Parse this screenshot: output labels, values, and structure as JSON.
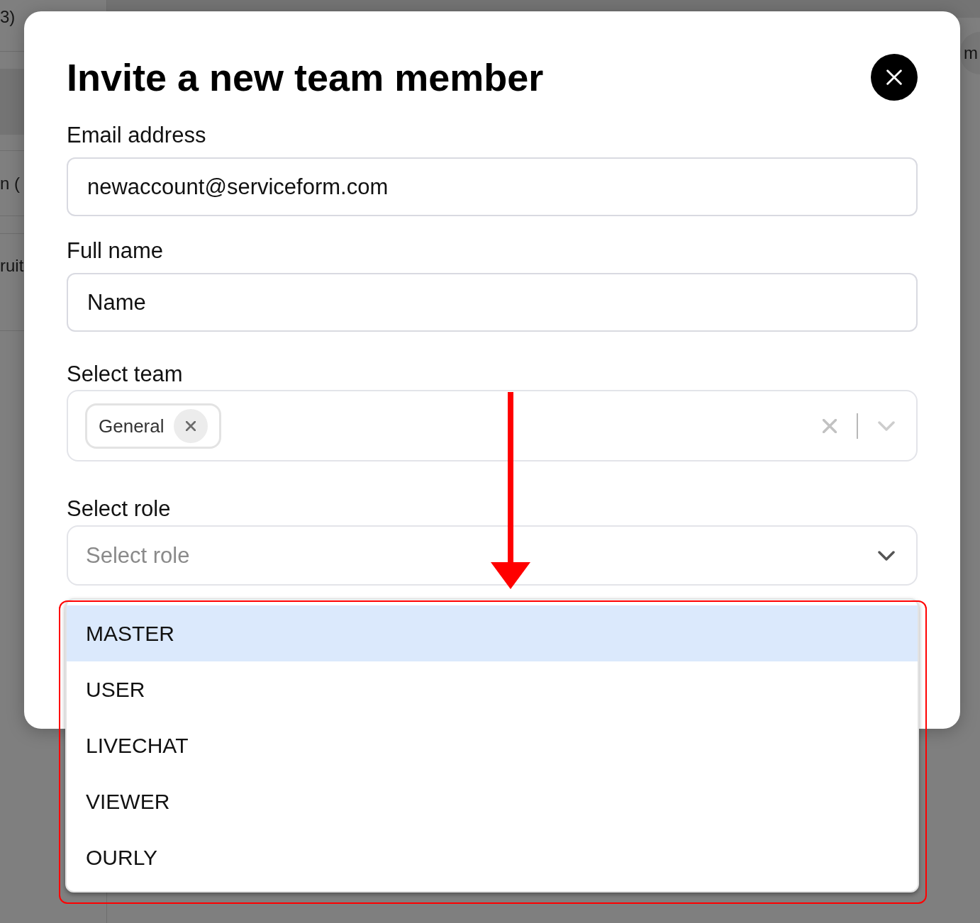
{
  "background": {
    "rows": [
      {
        "text": "3)"
      },
      {
        "text": "n ("
      },
      {
        "text": "ruit"
      }
    ],
    "header_button": {
      "label": "m"
    }
  },
  "dialog": {
    "title": "Invite a new team member",
    "fields": [
      {
        "kind": "text",
        "label": "Email address",
        "value": "newaccount@serviceform.com"
      },
      {
        "kind": "text",
        "label": "Full name",
        "value": "Name"
      },
      {
        "kind": "multiselect",
        "label": "Select team",
        "tags": [
          {
            "label": "General"
          }
        ]
      },
      {
        "kind": "select",
        "label": "Select role",
        "placeholder": "Select role",
        "expanded": true,
        "options": [
          {
            "label": "MASTER",
            "selected": true
          },
          {
            "label": "USER",
            "selected": false
          },
          {
            "label": "LIVECHAT",
            "selected": false
          },
          {
            "label": "VIEWER",
            "selected": false
          },
          {
            "label": "OURLY",
            "selected": false
          }
        ]
      }
    ]
  },
  "annotations": {
    "arrow": true,
    "highlight_frame": true
  }
}
